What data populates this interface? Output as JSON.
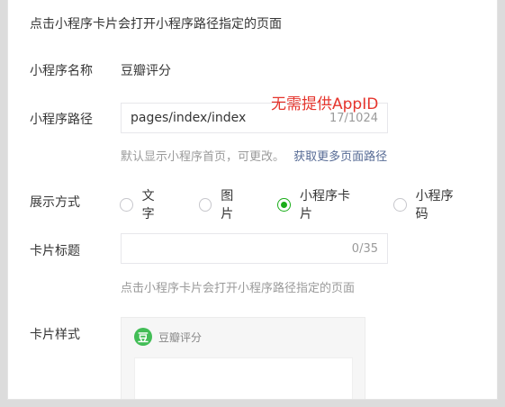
{
  "top_note": "点击小程序卡片会打开小程序路径指定的页面",
  "app_name_label": "小程序名称",
  "app_name_value": "豆瓣评分",
  "path_label": "小程序路径",
  "path_value": "pages/index/index",
  "path_count": "17/1024",
  "annotation": "无需提供AppID",
  "path_hint": "默认显示小程序首页，可更改。",
  "path_hint_link": "获取更多页面路径",
  "display_label": "展示方式",
  "display_options": [
    {
      "label": "文字",
      "checked": false
    },
    {
      "label": "图片",
      "checked": false
    },
    {
      "label": "小程序卡片",
      "checked": true
    },
    {
      "label": "小程序码",
      "checked": false
    }
  ],
  "card_title_label": "卡片标题",
  "card_title_value": "",
  "card_title_count": "0/35",
  "card_title_hint": "点击小程序卡片会打开小程序路径指定的页面",
  "card_style_label": "卡片样式",
  "card_preview": {
    "logo_char": "豆",
    "app_name": "豆瓣评分"
  },
  "colors": {
    "accent_green": "#1aad19",
    "link_blue": "#576b95",
    "annotation_red": "#e5352d",
    "douban_green": "#42bd56"
  }
}
